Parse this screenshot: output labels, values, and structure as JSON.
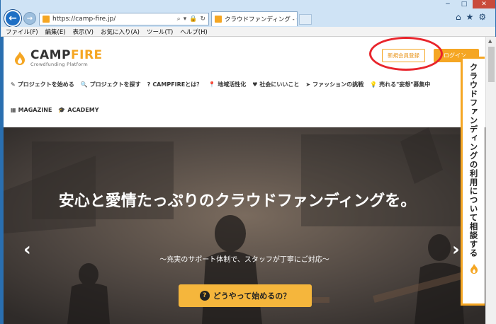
{
  "browser": {
    "url": "https://camp-fire.jp/",
    "tab_title": "クラウドファンディング - CAMP...",
    "tab_close": "×",
    "menu": [
      "ファイル(F)",
      "編集(E)",
      "表示(V)",
      "お気に入り(A)",
      "ツール(T)",
      "ヘルプ(H)"
    ]
  },
  "header": {
    "logo_main_1": "CAMP",
    "logo_main_2": "FIRE",
    "logo_sub": "Crowdfunding Platform",
    "signup_label": "新規会員登録",
    "login_label": "ログイン"
  },
  "nav": {
    "items": [
      {
        "icon": "✎",
        "label": "プロジェクトを始める"
      },
      {
        "icon": "🔍",
        "label": "プロジェクトを探す"
      },
      {
        "icon": "?",
        "label": "CAMPFIREとは？"
      },
      {
        "icon": "📍",
        "label": "地域活性化"
      },
      {
        "icon": "♥",
        "label": "社会にいいこと"
      },
      {
        "icon": "➤",
        "label": "ファッションの挑戦"
      },
      {
        "icon": "💡",
        "label": "売れる\"妄想\"募集中"
      },
      {
        "icon": "▦",
        "label": "MAGAZINE"
      },
      {
        "icon": "🎓",
        "label": "ACADEMY"
      }
    ]
  },
  "hero": {
    "title": "安心と愛情たっぷりのクラウドファンディングを。",
    "subtitle": "〜充実のサポート体制で、スタッフが丁寧にご対応〜",
    "cta_label": "どうやって始めるの？",
    "cta_icon": "?"
  },
  "side_tab": {
    "label": "クラウドファンディングの利用について相談する"
  },
  "colors": {
    "accent": "#f5a623",
    "highlight": "#e8252c"
  }
}
